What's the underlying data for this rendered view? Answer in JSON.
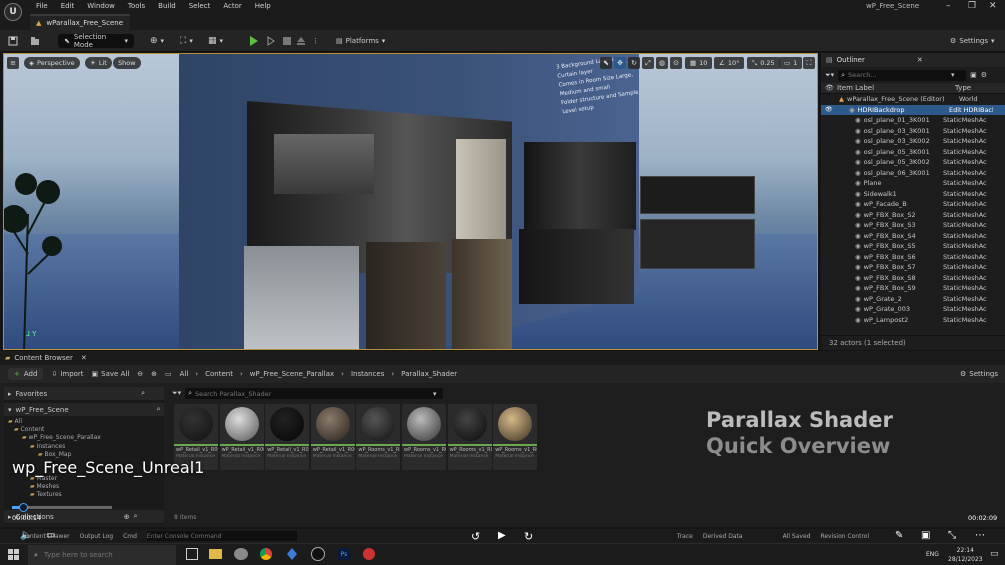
{
  "menubar": {
    "logo": "U",
    "items": [
      "File",
      "Edit",
      "Window",
      "Tools",
      "Build",
      "Select",
      "Actor",
      "Help"
    ],
    "project_title": "wP_Free_Scene"
  },
  "tab": {
    "label": "wParallax_Free_Scene"
  },
  "toolbar": {
    "selection_mode": "Selection Mode",
    "platforms": "Platforms",
    "settings": "Settings"
  },
  "viewport": {
    "perspective": "Perspective",
    "lit": "Lit",
    "show": "Show",
    "grid_snap": "10",
    "rot_snap": "10°",
    "scale_snap": "0.25",
    "cam_speed": "1",
    "axis_label": "Y",
    "wall_text": [
      "3 Background Layers",
      "Curtain layer",
      "Comes in Room Size Large, Medium and small",
      "Folder structure and Sample Level setup"
    ]
  },
  "outliner": {
    "title": "Outliner",
    "search_placeholder": "Search...",
    "col_label": "Item Label",
    "col_type": "Type",
    "rows": [
      {
        "label": "wParallax_Free_Scene (Editor)",
        "type": "World"
      },
      {
        "label": "HDRIBackdrop",
        "type": "Edit HDRIBack"
      },
      {
        "label": "osl_plane_01_3K001",
        "type": "StaticMeshAc"
      },
      {
        "label": "osl_plane_03_3K001",
        "type": "StaticMeshAc"
      },
      {
        "label": "osl_plane_03_3K002",
        "type": "StaticMeshAc"
      },
      {
        "label": "osl_plane_05_3K001",
        "type": "StaticMeshAc"
      },
      {
        "label": "osl_plane_05_3K002",
        "type": "StaticMeshAc"
      },
      {
        "label": "osl_plane_06_3K001",
        "type": "StaticMeshAc"
      },
      {
        "label": "Plane",
        "type": "StaticMeshAc"
      },
      {
        "label": "Sidewalk1",
        "type": "StaticMeshAc"
      },
      {
        "label": "wP_Facade_B",
        "type": "StaticMeshAc"
      },
      {
        "label": "wP_FBX_Box_S2",
        "type": "StaticMeshAc"
      },
      {
        "label": "wP_FBX_Box_S3",
        "type": "StaticMeshAc"
      },
      {
        "label": "wP_FBX_Box_S4",
        "type": "StaticMeshAc"
      },
      {
        "label": "wP_FBX_Box_S5",
        "type": "StaticMeshAc"
      },
      {
        "label": "wP_FBX_Box_S6",
        "type": "StaticMeshAc"
      },
      {
        "label": "wP_FBX_Box_S7",
        "type": "StaticMeshAc"
      },
      {
        "label": "wP_FBX_Box_S8",
        "type": "StaticMeshAc"
      },
      {
        "label": "wP_FBX_Box_S9",
        "type": "StaticMeshAc"
      },
      {
        "label": "wP_Grate_2",
        "type": "StaticMeshAc"
      },
      {
        "label": "wP_Grate_003",
        "type": "StaticMeshAc"
      },
      {
        "label": "wP_Lampost2",
        "type": "StaticMeshAc"
      }
    ],
    "status": "32 actors (1 selected)"
  },
  "content_browser": {
    "tab_title": "Content Browser",
    "add": "Add",
    "import": "Import",
    "save_all": "Save All",
    "breadcrumb": [
      "All",
      "Content",
      "wP_Free_Scene_Parallax",
      "Instances",
      "Parallax_Shader"
    ],
    "settings": "Settings",
    "favorites": "Favorites",
    "project": "wP_Free_Scene",
    "search_placeholder": "Search Parallax_Shader",
    "tree": [
      "All",
      "Content",
      "wP_Free_Scene_Parallax",
      "Instances",
      "Box_Map",
      "Master",
      "Meshes",
      "Textures"
    ],
    "assets": [
      {
        "name": "wP_Retail_v1_R00_S_day_2k",
        "type": "Material Instance"
      },
      {
        "name": "wP_Retail_v1_R00_S_day_2k",
        "type": "Material Instance"
      },
      {
        "name": "wP_Retail_v1_R01_S_night_2k",
        "type": "Material Instance"
      },
      {
        "name": "wP_Retail_v1_R00_S_night",
        "type": "Material Instance"
      },
      {
        "name": "wP_Rooms_v1_R00_L_day",
        "type": "Material Instance"
      },
      {
        "name": "wP_Rooms_v1_R00_S_day",
        "type": "Material Instance"
      },
      {
        "name": "wP_Rooms_v1_R00_S_night",
        "type": "Material Instance"
      },
      {
        "name": "wP_Rooms_v1_R00_S_day",
        "type": "Material Instance"
      }
    ],
    "item_count": "8 items",
    "collections": "Collections",
    "overlay_title_1": "Parallax Shader",
    "overlay_title_2": "Quick Overview"
  },
  "video": {
    "caption": "wp_Free_Scene_Unreal1",
    "time_current": "00:00:14",
    "time_total": "00:02:09",
    "progress": 0.11
  },
  "statusbar": {
    "drawer": "Content Drawer",
    "output_log": "Output Log",
    "cmd": "Cmd",
    "console_placeholder": "Enter Console Command",
    "trace": "Trace",
    "derived_data": "Derived Data",
    "all_saved": "All Saved",
    "revision": "Revision Control"
  },
  "taskbar": {
    "search_placeholder": "Type here to search",
    "lang": "ENG",
    "time": "22:14",
    "date": "28/12/2023"
  },
  "colors": {
    "accent": "#b8923a",
    "selected": "#2d5a8a",
    "play": "#5fbf3f"
  }
}
